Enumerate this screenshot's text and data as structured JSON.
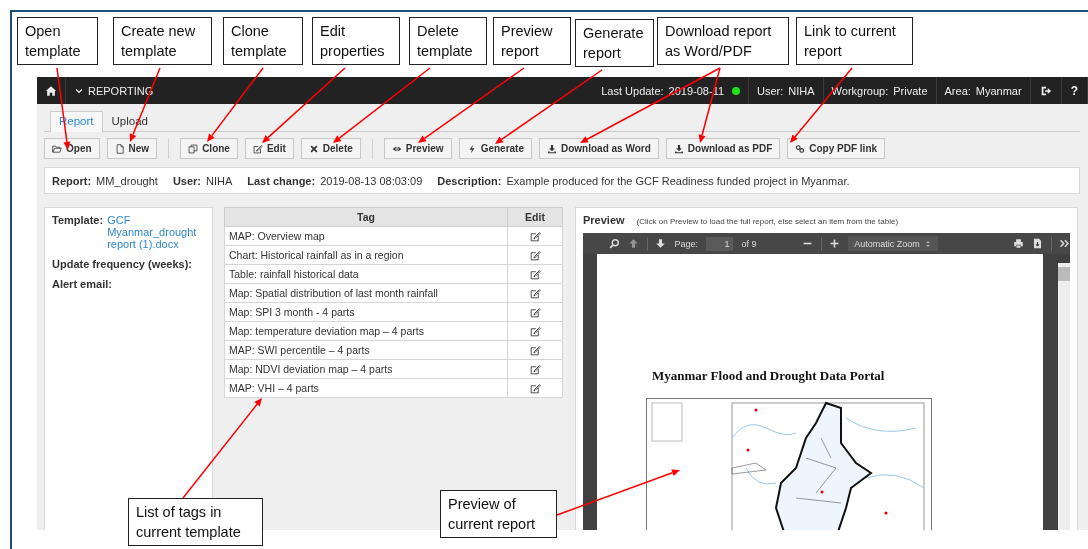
{
  "callouts": [
    {
      "text": "Open template"
    },
    {
      "text": "Create new template"
    },
    {
      "text": "Clone template"
    },
    {
      "text": "Edit properties"
    },
    {
      "text": "Delete template"
    },
    {
      "text": "Preview report"
    },
    {
      "text": "Generate report"
    },
    {
      "text": "Download report as Word/PDF"
    },
    {
      "text": "Link to current report"
    },
    {
      "text": "List of tags in current template"
    },
    {
      "text": "Preview of current report"
    }
  ],
  "topbar": {
    "section": "REPORTING",
    "status_label": "Last Update:",
    "status_value": "2019-08-11",
    "status_ok": true,
    "items": [
      {
        "label": "User:",
        "value": "NIHA"
      },
      {
        "label": "Workgroup:",
        "value": "Private"
      },
      {
        "label": "Area:",
        "value": "Myanmar"
      }
    ],
    "help": "?"
  },
  "tabs": [
    {
      "label": "Report",
      "selected": true
    },
    {
      "label": "Upload",
      "selected": false
    }
  ],
  "toolbar": [
    [
      {
        "kind": "open",
        "label": "Open"
      },
      {
        "kind": "new",
        "label": "New"
      }
    ],
    [
      {
        "kind": "clone",
        "label": "Clone"
      },
      {
        "kind": "edit",
        "label": "Edit"
      },
      {
        "kind": "delete",
        "label": "Delete"
      }
    ],
    [
      {
        "kind": "preview",
        "label": "Preview"
      },
      {
        "kind": "generate",
        "label": "Generate"
      },
      {
        "kind": "download",
        "label": "Download as Word"
      },
      {
        "kind": "download",
        "label": "Download as PDF"
      },
      {
        "kind": "link",
        "label": "Copy PDF link"
      }
    ]
  ],
  "report_info": [
    {
      "label": "Report:",
      "value": "MM_drought"
    },
    {
      "label": "User:",
      "value": "NIHA"
    },
    {
      "label": "Last change:",
      "value": "2019-08-13 08:03:09"
    },
    {
      "label": "Description:",
      "value": "Example produced for the GCF Readiness funded project in Myanmar."
    }
  ],
  "template_panel": {
    "template_label": "Template:",
    "template_file": "GCF Myanmar_drought report (1).docx",
    "fields": [
      "Update frequency (weeks):",
      "Alert email:"
    ]
  },
  "tag_table": {
    "columns": [
      "Tag",
      "Edit"
    ],
    "rows": [
      "MAP: Overview map",
      "Chart: Historical rainfall as in a region",
      "Table: rainfall historical data",
      "Map: Spatial distribution of last month rainfall",
      "Map: SPI 3 month - 4 parts",
      "Map: temperature deviation map – 4 parts",
      "MAP: SWI percentile – 4 parts",
      "Map: NDVI deviation map – 4 parts",
      "MAP: VHI – 4 parts"
    ]
  },
  "preview": {
    "title": "Preview",
    "hint": "(Click on Preview to load the full report, else select an item from the table)",
    "viewer": {
      "page_label": "Page:",
      "page": "1",
      "page_count": "of 9",
      "zoom": "Automatic Zoom",
      "document_title": "Myanmar Flood and Drought Data Portal"
    }
  }
}
